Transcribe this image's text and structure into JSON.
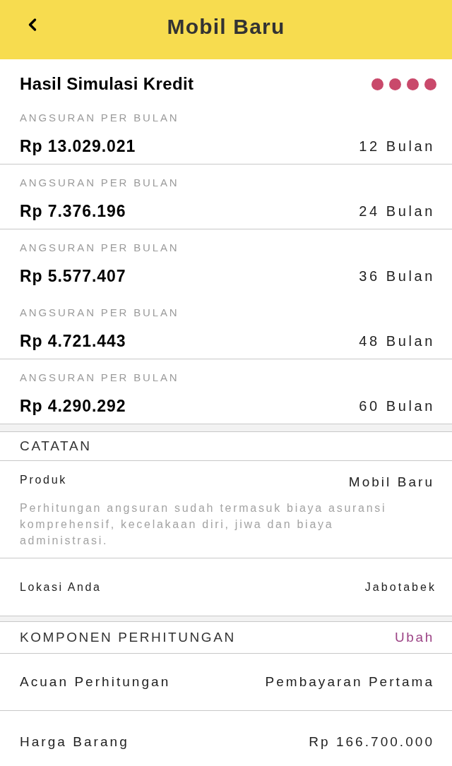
{
  "header": {
    "title": "Mobil Baru"
  },
  "simulation": {
    "title": "Hasil Simulasi Kredit",
    "installments": [
      {
        "label": "ANGSURAN PER BULAN",
        "amount": "Rp 13.029.021",
        "tenor": "12 Bulan",
        "divider": true
      },
      {
        "label": "ANGSURAN PER BULAN",
        "amount": "Rp 7.376.196",
        "tenor": "24 Bulan",
        "divider": true
      },
      {
        "label": "ANGSURAN PER BULAN",
        "amount": "Rp 5.577.407",
        "tenor": "36 Bulan",
        "divider": false
      },
      {
        "label": "ANGSURAN PER BULAN",
        "amount": "Rp 4.721.443",
        "tenor": "48 Bulan",
        "divider": true
      },
      {
        "label": "ANGSURAN PER BULAN",
        "amount": "Rp 4.290.292",
        "tenor": "60 Bulan",
        "divider": true
      }
    ]
  },
  "notes": {
    "heading": "CATATAN",
    "product": {
      "label": "Produk",
      "value": "Mobil Baru",
      "note": "Perhitungan angsuran sudah termasuk biaya asuransi komprehensif, kecelakaan diri, jiwa dan biaya administrasi."
    },
    "location": {
      "label": "Lokasi Anda",
      "value": "Jabotabek"
    }
  },
  "components": {
    "heading": "KOMPONEN PERHITUNGAN",
    "edit_link": "Ubah",
    "rows": [
      {
        "label": "Acuan Perhitungan",
        "value": "Pembayaran Pertama"
      },
      {
        "label": "Harga Barang",
        "value": "Rp 166.700.000"
      }
    ]
  }
}
